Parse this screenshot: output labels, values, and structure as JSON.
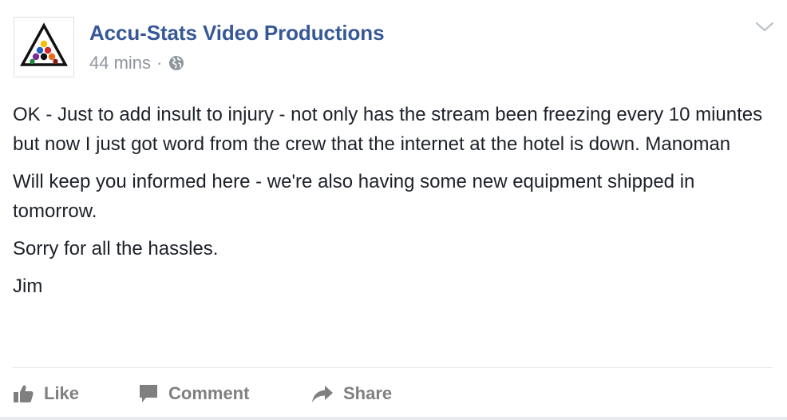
{
  "post": {
    "page_name": "Accu-Stats Video Productions",
    "timestamp": "44 mins",
    "separator": "·",
    "privacy_icon": "globe-icon",
    "menu_icon": "chevron-down-icon",
    "paragraphs": [
      "OK - Just to add insult to injury - not only has the stream been freezing every 10 miuntes but now I just got word from the crew that the internet at the hotel is down. Manoman",
      "Will keep you informed here - we're also having some new equipment shipped in tomorrow.",
      "Sorry for all the hassles.",
      "Jim"
    ]
  },
  "actions": {
    "like_label": "Like",
    "like_icon": "thumbs-up-icon",
    "comment_label": "Comment",
    "comment_icon": "speech-bubble-icon",
    "share_label": "Share",
    "share_icon": "share-arrow-icon"
  },
  "colors": {
    "link_blue": "#365899",
    "meta_gray": "#90949c",
    "action_gray": "#7f7f7f",
    "text": "#1d2129"
  }
}
